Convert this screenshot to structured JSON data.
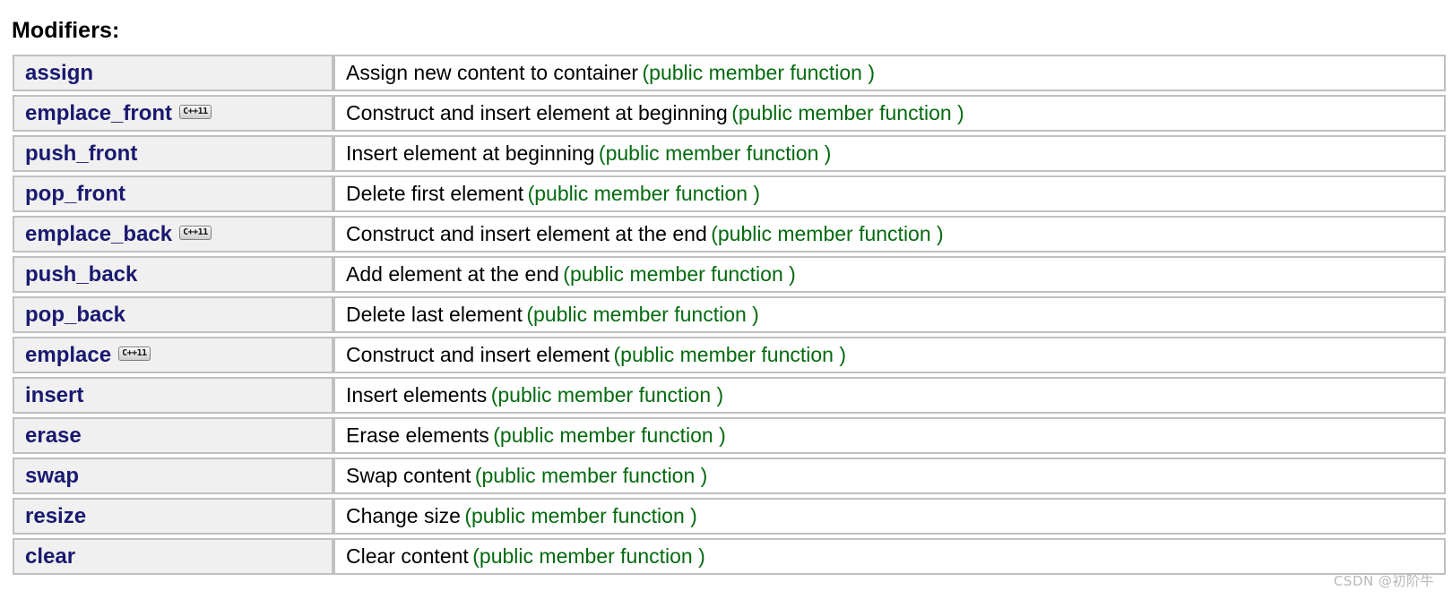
{
  "heading": "Modifiers:",
  "badge_label": "C++11",
  "colors": {
    "member_name": "#191970",
    "note_green": "#046a0f",
    "cell_bg": "#f0f0f0",
    "border": "#c0c0c0"
  },
  "note_text": "(public member function )",
  "watermark": "CSDN @初阶牛",
  "rows": [
    {
      "name": "assign",
      "badge": "",
      "desc": "Assign new content to container",
      "note": "(public member function )"
    },
    {
      "name": "emplace_front",
      "badge": "C++11",
      "desc": "Construct and insert element at beginning",
      "note": "(public member function )"
    },
    {
      "name": "push_front",
      "badge": "",
      "desc": "Insert element at beginning",
      "note": "(public member function )"
    },
    {
      "name": "pop_front",
      "badge": "",
      "desc": "Delete first element",
      "note": "(public member function )"
    },
    {
      "name": "emplace_back",
      "badge": "C++11",
      "desc": "Construct and insert element at the end",
      "note": "(public member function )"
    },
    {
      "name": "push_back",
      "badge": "",
      "desc": "Add element at the end",
      "note": "(public member function )"
    },
    {
      "name": "pop_back",
      "badge": "",
      "desc": "Delete last element",
      "note": "(public member function )"
    },
    {
      "name": "emplace",
      "badge": "C++11",
      "desc": "Construct and insert element",
      "note": "(public member function )"
    },
    {
      "name": "insert",
      "badge": "",
      "desc": "Insert elements",
      "note": "(public member function )"
    },
    {
      "name": "erase",
      "badge": "",
      "desc": "Erase elements",
      "note": "(public member function )"
    },
    {
      "name": "swap",
      "badge": "",
      "desc": "Swap content",
      "note": "(public member function )"
    },
    {
      "name": "resize",
      "badge": "",
      "desc": "Change size",
      "note": "(public member function )"
    },
    {
      "name": "clear",
      "badge": "",
      "desc": "Clear content",
      "note": "(public member function )"
    }
  ]
}
